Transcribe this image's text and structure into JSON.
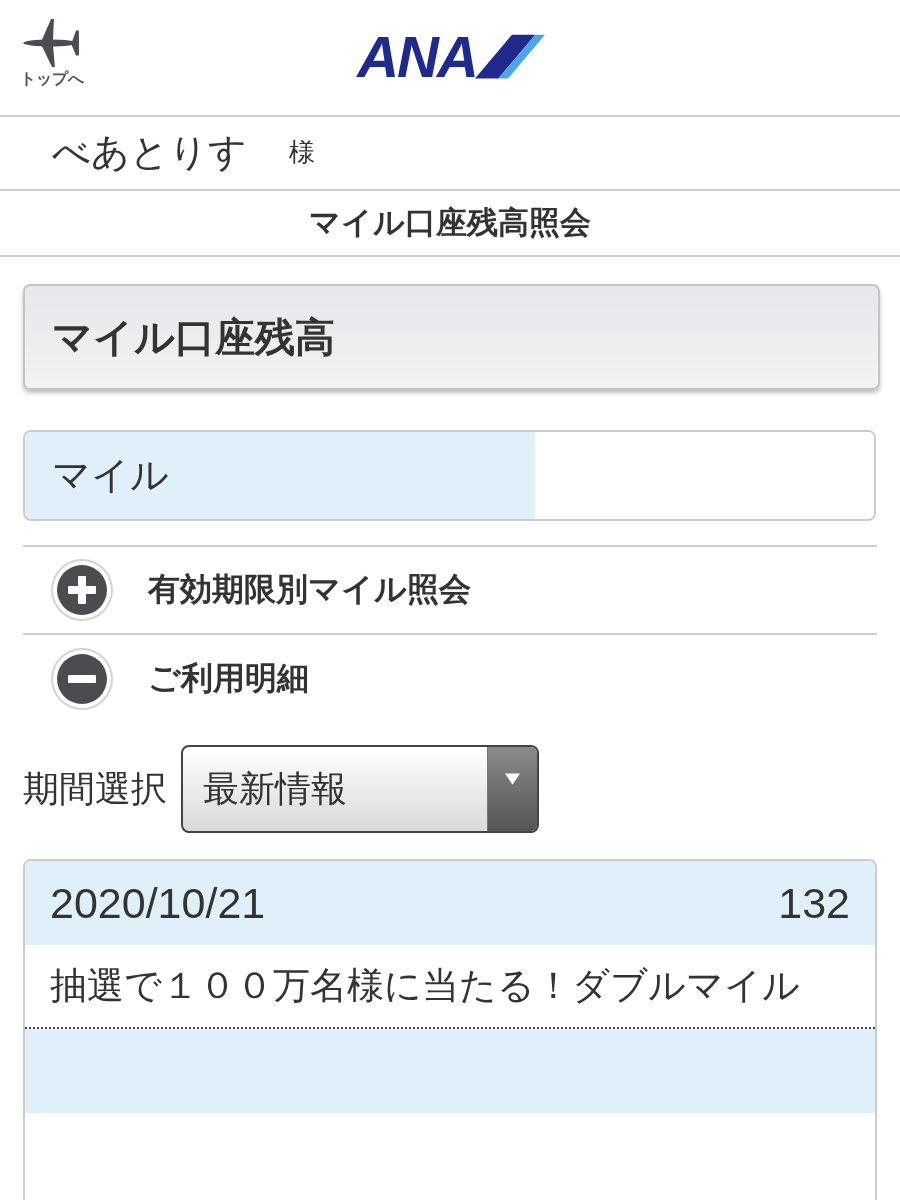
{
  "header": {
    "home_link": {
      "label": "トップへ"
    },
    "logo": {
      "text": "ANA"
    }
  },
  "user": {
    "name": "べあとりす",
    "honorific": "様"
  },
  "page_title": "マイル口座残高照会",
  "balance_card": {
    "heading": "マイル口座残高",
    "balance_label": "マイル"
  },
  "sections": [
    {
      "label": "有効期限別マイル照会",
      "expanded": false
    },
    {
      "label": "ご利用明細",
      "expanded": true,
      "period_select": {
        "label": "期間選択",
        "value": "最新情報"
      },
      "history": [
        {
          "date": "2020/10/21",
          "miles": "132",
          "description": "抽選で１００万名様に当たる！ダブルマイル"
        }
      ]
    }
  ]
}
